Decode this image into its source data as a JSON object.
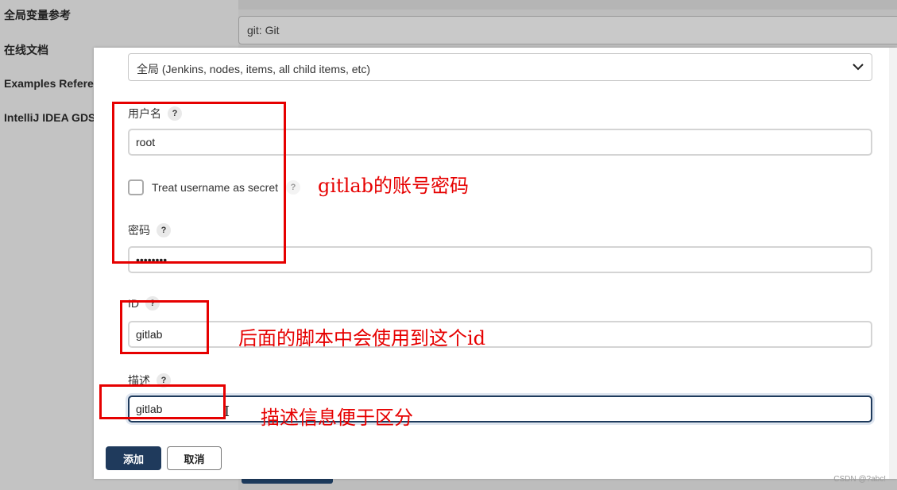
{
  "background": {
    "links": [
      "全局变量参考",
      "在线文档",
      "Examples Reference",
      "IntelliJ IDEA GDSL"
    ],
    "select_value": "git: Git"
  },
  "dialog": {
    "scope_select": "全局 (Jenkins, nodes, items, all child items, etc)",
    "username_label": "用户名",
    "username_value": "root",
    "treat_secret_label": "Treat username as secret",
    "password_label": "密码",
    "password_value": "••••••••",
    "id_label": "ID",
    "id_value": "gitlab",
    "desc_label": "描述",
    "desc_value": "gitlab",
    "help_glyph": "?",
    "add_button": "添加",
    "cancel_button": "取消"
  },
  "annotations": {
    "account": "gitlab的账号密码",
    "id_note": "后面的脚本中会使用到这个id",
    "desc_note": "描述信息便于区分",
    "accent_color": "#e60000"
  },
  "icons": {
    "chevron": "chevron-down-icon",
    "help": "help-icon"
  },
  "watermark": "CSDN @?abc!"
}
